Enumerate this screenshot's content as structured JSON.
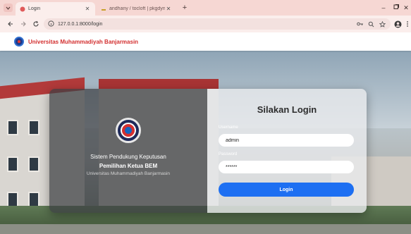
{
  "browser": {
    "active_tab_title": "Login",
    "inactive_tab_title": "andhany / tocloft | pkgdyn",
    "url": "127.0.0.1:8000/login"
  },
  "navbar": {
    "brand_name": "Universitas Muhammadiyah Banjarmasin"
  },
  "hero": {
    "app_title_line1": "Sistem Pendukung Keputusan",
    "app_title_line2": "Pemilihan Ketua BEM",
    "institution": "Universitas Muhammadiyah Banjarmasin"
  },
  "login_form": {
    "heading": "Silakan Login",
    "username_label": "Username",
    "username_value": "admin",
    "password_label": "Password",
    "password_value": "******",
    "submit_label": "Login"
  },
  "colors": {
    "brand_red": "#d32f2f",
    "button_blue": "#1d6ff2",
    "tabstrip": "#f6d7d3"
  }
}
